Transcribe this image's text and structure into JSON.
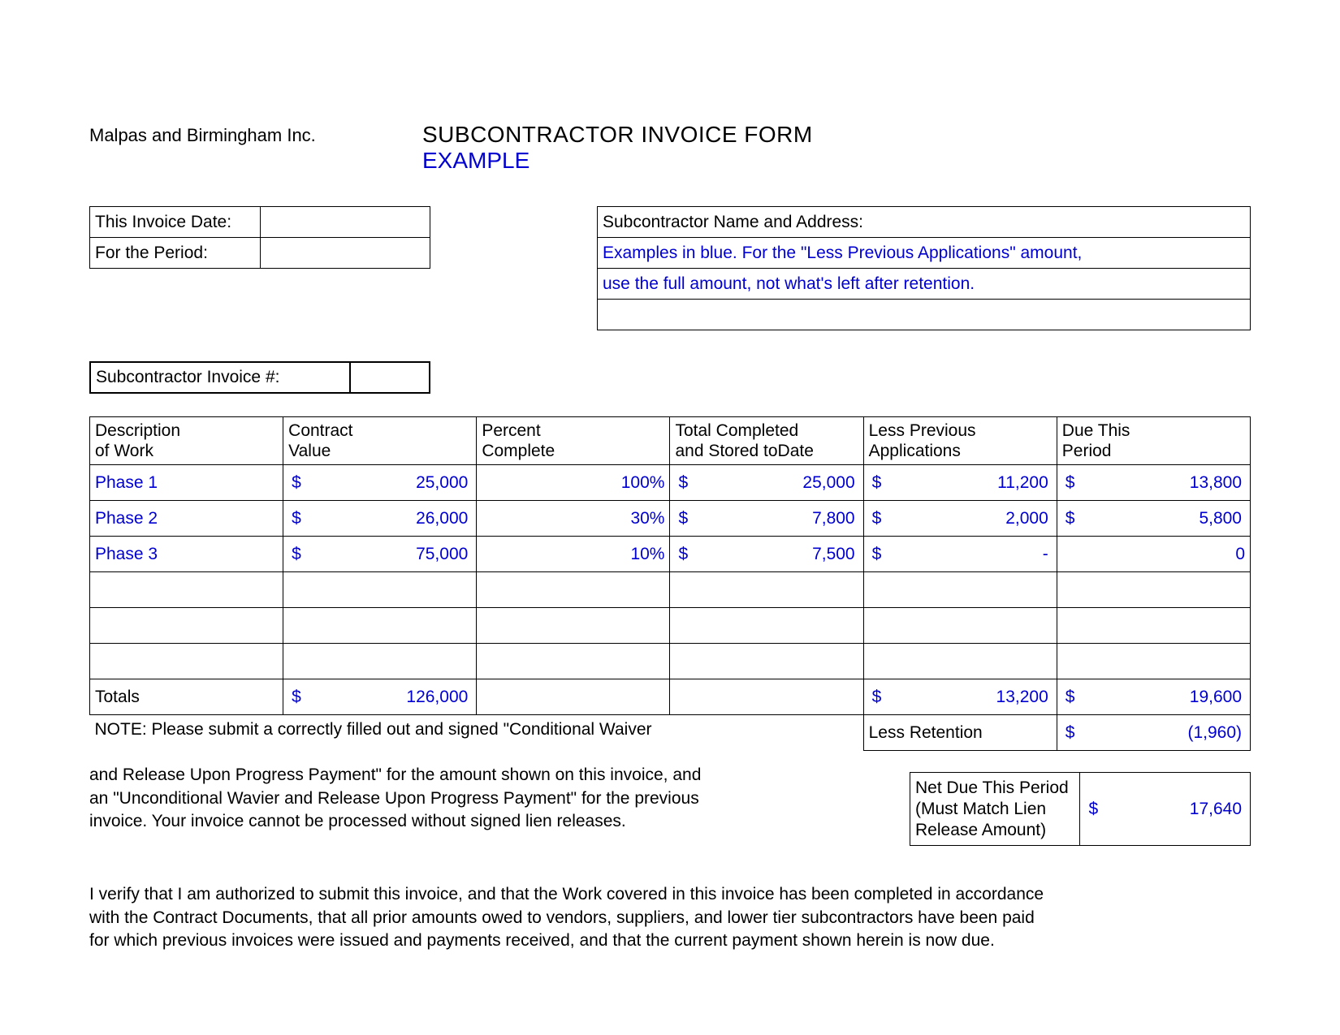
{
  "company": "Malpas and Birmingham Inc.",
  "title1": "SUBCONTRACTOR INVOICE FORM",
  "title2": "EXAMPLE",
  "left_info": {
    "invoice_date_label": "This Invoice Date:",
    "period_label": "For the Period:",
    "sub_invoice_label": "Subcontractor Invoice #:"
  },
  "right_info": {
    "name_addr_label": "Subcontractor Name and Address:",
    "example_line1": "Examples in blue.  For the \"Less Previous Applications\" amount,",
    "example_line2": "use the full amount, not what's left after retention."
  },
  "headers": {
    "c1a": "Description",
    "c1b": "of Work",
    "c2a": "Contract",
    "c2b": "Value",
    "c3a": "Percent",
    "c3b": "Complete",
    "c4a": "Total Completed",
    "c4b": "and Stored toDate",
    "c5a": "Less Previous",
    "c5b": "Applications",
    "c6a": "Due This",
    "c6b": "Period"
  },
  "rows": [
    {
      "desc": "Phase 1",
      "contract": "25,000",
      "percent": "100%",
      "total": "25,000",
      "less": "11,200",
      "due": "13,800"
    },
    {
      "desc": "Phase 2",
      "contract": "26,000",
      "percent": "30%",
      "total": "7,800",
      "less": "2,000",
      "due": "5,800"
    },
    {
      "desc": "Phase 3",
      "contract": "75,000",
      "percent": "10%",
      "total": "7,500",
      "less": "-",
      "due": "0",
      "due_no_sym": true
    }
  ],
  "totals": {
    "label": "Totals",
    "contract": "126,000",
    "less": "13,200",
    "due": "19,600"
  },
  "note": {
    "l1": "NOTE:  Please submit a correctly filled out and signed \"Conditional Waiver",
    "l2": "and Release Upon Progress Payment\" for the amount shown on this invoice, and",
    "l3": "an \"Unconditional Wavier and Release Upon Progress Payment\" for the previous",
    "l4": "invoice. Your invoice cannot be processed without signed lien releases."
  },
  "retention": {
    "label": "Less Retention",
    "value": "(1,960)"
  },
  "net": {
    "l1": "Net Due This Period",
    "l2": "(Must Match Lien",
    "l3": "Release Amount)",
    "value": "17,640"
  },
  "verify": {
    "l1": "I verify that I am authorized to submit this invoice, and that the Work covered in this invoice has been completed in accordance",
    "l2": "with the Contract Documents, that all prior amounts owed to vendors, suppliers, and lower tier subcontractors have been paid",
    "l3": "for which previous invoices were issued and payments received, and that the current payment shown herein is now due."
  },
  "sym": "$"
}
